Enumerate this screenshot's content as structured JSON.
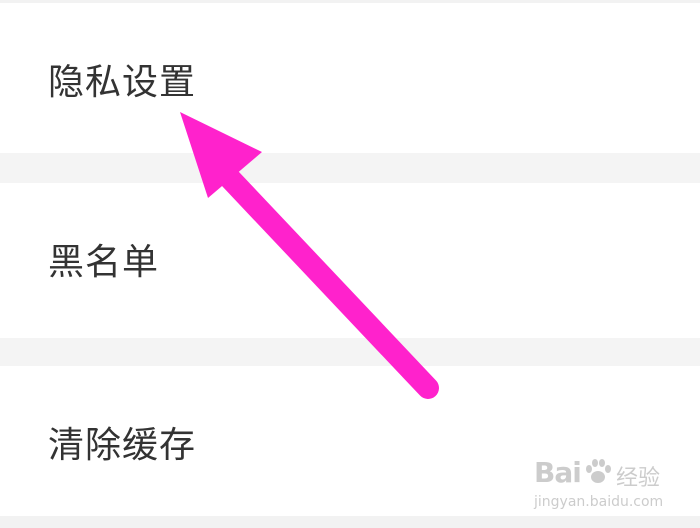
{
  "settings": {
    "items": [
      {
        "label": "隐私设置"
      },
      {
        "label": "黑名单"
      },
      {
        "label": "清除缓存"
      }
    ]
  },
  "annotation": {
    "arrow_color": "#ff22cc",
    "arrow_icon": "arrow-pointer-icon"
  },
  "watermark": {
    "logo_text": "Bai",
    "logo_suffix": "经验",
    "url": "jingyan.baidu.com",
    "icon": "baidu-paw-icon"
  }
}
